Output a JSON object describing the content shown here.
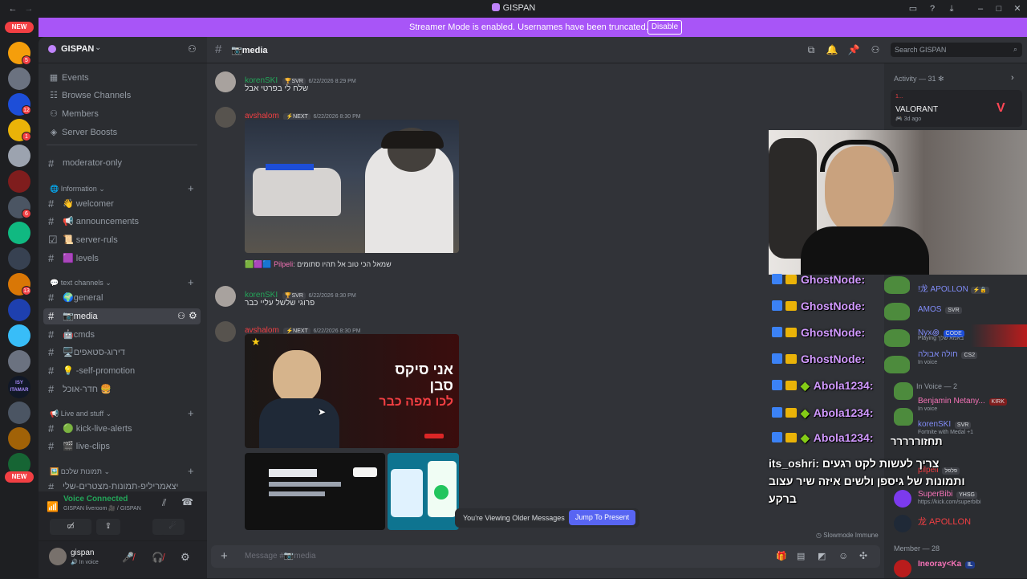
{
  "window": {
    "title": "GISPAN"
  },
  "banner": {
    "text": "Streamer Mode is enabled. Usernames have been truncated.",
    "button": "Disable"
  },
  "rail": {
    "new_top": "NEW",
    "new_bottom": "NEW",
    "badges": [
      "5",
      "12",
      "1",
      "6",
      "13"
    ],
    "itamar_label": "ISY ITAMAR"
  },
  "server": {
    "name": "GISPAN"
  },
  "nav": [
    {
      "icon": "calendar-icon",
      "label": "Events"
    },
    {
      "icon": "browse-icon",
      "label": "Browse Channels"
    },
    {
      "icon": "members-icon",
      "label": "Members"
    },
    {
      "icon": "boost-icon",
      "label": "Server Boosts"
    }
  ],
  "channels": {
    "moderator": "moderator-only",
    "cat_information": "Information",
    "welcomer": "welcomer",
    "announcements": "announcements",
    "server_ruls": "server-ruls",
    "levels": "levels",
    "cat_text": "text channels",
    "general": "general",
    "media": "media",
    "cmds": "cmds",
    "drug": "דירוג-סטאפים",
    "promo": "-self-promotion",
    "kitchen": "חדר-אוכל",
    "cat_live": "Live and stuff",
    "kick_alerts": "kick-live-alerts",
    "live_clips": "live-clips",
    "cat_photos": "תמונות שלכם",
    "cut_off": "יצאמריליפ-תמונות-מצטרים-שלי"
  },
  "voice": {
    "status": "Voice Connected",
    "location": "GISPAN liveroom 🎥 / GISPAN"
  },
  "user": {
    "name": "gispan",
    "status": "In voice"
  },
  "chat": {
    "channel": "media",
    "search_placeholder": "Search GISPAN",
    "messages": [
      {
        "author": "korenSKI",
        "tag": "SVR",
        "time": "6/22/2026 8:29 PM",
        "text": "שלח לי בפרטי אבל"
      },
      {
        "author": "avshalom",
        "tag": "NEXT",
        "time": "6/22/2026 8:30 PM",
        "caption_name": "Pilpeli",
        "caption": "שמאל הכי טוב אל תהיו סתומים"
      },
      {
        "author": "korenSKI",
        "tag": "SVR",
        "time": "6/22/2026 8:30 PM",
        "text": "פרוגי שלשל עליי כבר"
      },
      {
        "author": "avshalom",
        "tag": "NEXT",
        "time": "6/22/2026 8:30 PM"
      }
    ],
    "embed_text": [
      "אני סיקס",
      "סבן",
      "לכו מפה כבר"
    ],
    "older_text": "You're Viewing Older Messages",
    "jump": "Jump To Present",
    "composer_placeholder": "Message #📷media",
    "slowmode": "Slowmode Immune"
  },
  "activity": {
    "header": "Activity — 31",
    "game": "VALORANT",
    "ago": "3d ago",
    "pre": "1..."
  },
  "overlay": {
    "rows": [
      {
        "name": "GhostNode:",
        "icons": 2
      },
      {
        "name": "GhostNode:",
        "icons": 2
      },
      {
        "name": "GhostNode:",
        "icons": 2
      },
      {
        "name": "GhostNode:",
        "icons": 2
      },
      {
        "name": "Abola1234:",
        "icons": 3
      },
      {
        "name": "Abola1234:",
        "icons": 3
      },
      {
        "name": "Abola1234:",
        "icons": 3
      }
    ],
    "tail": "תחזוררררר",
    "oshri_name": "its_oshri:",
    "oshri_line1": "צריך לעשות לקט רגעים",
    "oshri_line2": "ותמונות של גיספן ולשים איזה שיר עצוב",
    "oshri_line3": "ברקע"
  },
  "members": {
    "in_voice_group": "In Voice — 2",
    "member_group": "Member — 28",
    "list": [
      {
        "name": "!龙 APOLLON",
        "tag": "",
        "sub": ""
      },
      {
        "name": "AMOS",
        "tag": "SVR",
        "sub": ""
      },
      {
        "name": "Nyx꩜",
        "tag": "CODE",
        "sub": "Playing באמא שלך"
      },
      {
        "name": "חולה אבולה",
        "tag": "CS2",
        "sub": "In voice"
      },
      {
        "name": "Benjamin Netany...",
        "tag": "KIRK",
        "sub": "In voice"
      },
      {
        "name": "korenSKI",
        "tag": "SVR",
        "sub": "Fortnite with Medal +1"
      },
      {
        "name": "pilpeli",
        "tag": "פלפל",
        "sub": ""
      },
      {
        "name": "SuperBibi",
        "tag": "YHSG",
        "sub": "https://kick.com/superbibi"
      },
      {
        "name": "龙 APOLLON",
        "tag": "",
        "sub": ""
      },
      {
        "name": "Ineoray<Ka",
        "tag": "IL",
        "sub": ""
      }
    ]
  },
  "colors": {
    "accent": "#5865f2",
    "banner": "#a855f7",
    "green": "#23a559",
    "overlay_name": "#d199ff"
  }
}
